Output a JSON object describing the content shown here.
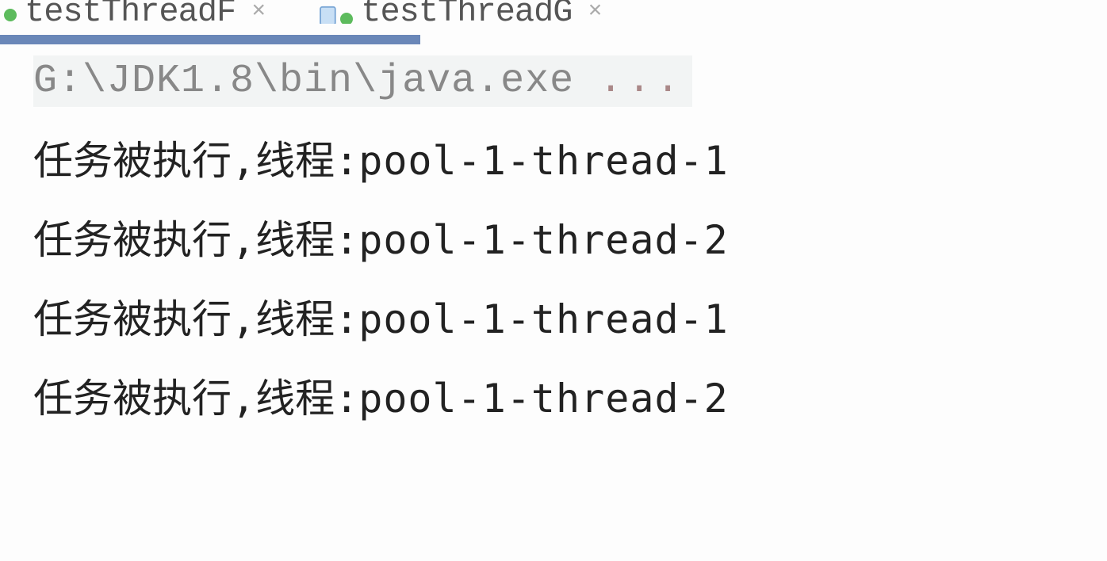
{
  "tabs": {
    "active_label": "testThreadF",
    "inactive_label": "testThreadG"
  },
  "console": {
    "command": "G:\\JDK1.8\\bin\\java.exe ",
    "command_suffix": "...",
    "lines": [
      {
        "prefix": "任务被执行,线程:",
        "thread": "pool-1-thread-1"
      },
      {
        "prefix": "任务被执行,线程:",
        "thread": "pool-1-thread-2"
      },
      {
        "prefix": "任务被执行,线程:",
        "thread": "pool-1-thread-1"
      },
      {
        "prefix": "任务被执行,线程:",
        "thread": "pool-1-thread-2"
      }
    ]
  }
}
